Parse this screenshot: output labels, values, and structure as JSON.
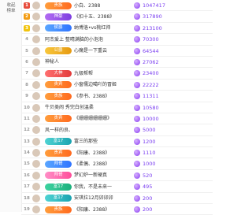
{
  "sidebar": {
    "collapse_label": "收起榜单"
  },
  "rows": [
    {
      "rank": "1",
      "badge": "贵族",
      "badge_style": "b-orange",
      "name": "小白、2388",
      "value": "1047417"
    },
    {
      "rank": "2",
      "badge": "神豪",
      "badge_style": "b-purple",
      "name": "《扣十五、2388》",
      "value": "317890"
    },
    {
      "rank": "3",
      "badge": "侯爵",
      "badge_style": "b-blue",
      "name": "纳博洛•vs桃红帅",
      "value": "213100"
    },
    {
      "rank": "4",
      "badge": "",
      "badge_style": "b-none",
      "name": "阿杰爱上  整晴满脑的小泡泡",
      "value": "70300"
    },
    {
      "rank": "5",
      "badge": "公爵",
      "badge_style": "b-gold",
      "name": "心魔是一下重云",
      "value": "64544"
    },
    {
      "rank": "6",
      "badge": "",
      "badge_style": "b-none",
      "name": "神秘人",
      "value": "27062"
    },
    {
      "rank": "7",
      "badge": "大神",
      "badge_style": "b-red",
      "name": "九极帮帮",
      "value": "23400"
    },
    {
      "rank": "8",
      "badge": "贵宾",
      "badge_style": "b-orange",
      "name": "小窗儒边噶吖的冒姬",
      "value": "22222"
    },
    {
      "rank": "9",
      "badge": "贵族",
      "badge_style": "b-orange",
      "name": "《参书、2388》",
      "value": "11311"
    },
    {
      "rank": "10",
      "badge": "",
      "badge_style": "b-none",
      "name": "牛贝类闹  秀完白创温柔",
      "value": "10580"
    },
    {
      "rank": "11",
      "badge": "贵宾",
      "badge_style": "b-orange",
      "name": "《姗姗姗姗姗姗》",
      "value": "10000"
    },
    {
      "rank": "12",
      "badge": "",
      "badge_style": "b-none",
      "name": "风一样的良、",
      "value": "5000"
    },
    {
      "rank": "13",
      "badge": "富17",
      "badge_style": "b-teal",
      "name": "富三的那些",
      "value": "1200"
    },
    {
      "rank": "14",
      "badge": "贵宾",
      "badge_style": "b-orange",
      "name": "《阳康、2388》",
      "value": "1110"
    },
    {
      "rank": "15",
      "badge": "帅哥",
      "badge_style": "b-blue",
      "name": "《柔偶、2388》",
      "value": "1000"
    },
    {
      "rank": "16",
      "badge": "帅哥",
      "badge_style": "b-pink",
      "name": "梦幻炉一新硬真",
      "value": "520"
    },
    {
      "rank": "17",
      "badge": "富17",
      "badge_style": "b-green",
      "name": "你我，不是未来一",
      "value": "495"
    },
    {
      "rank": "18",
      "badge": "富17",
      "badge_style": "b-teal",
      "name": "安琪拉12月卯卯卯",
      "value": "200"
    },
    {
      "rank": "19",
      "badge": "贵族",
      "badge_style": "b-orange",
      "name": "《阳康、2388》",
      "value": "200"
    }
  ]
}
